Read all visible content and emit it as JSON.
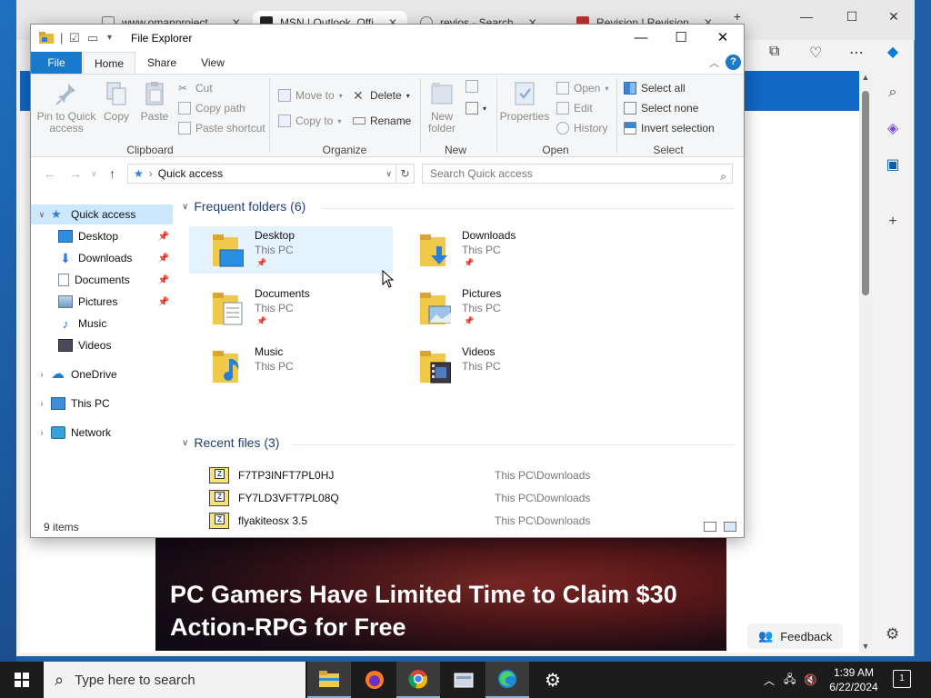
{
  "browser": {
    "tabs": [
      {
        "label": "www.omanproject...",
        "active": false
      },
      {
        "label": "MSN | Outlook, Offi",
        "active": true
      },
      {
        "label": "revios - Search",
        "active": false
      },
      {
        "label": "Revision | Revision",
        "active": false
      }
    ],
    "news_title": "PC Gamers Have Limited Time to Claim $30 Action-RPG for Free",
    "feedback_label": "Feedback",
    "brand_color": "#1168c7"
  },
  "explorer": {
    "title": "File Explorer",
    "ribbon_tabs": [
      "File",
      "Home",
      "Share",
      "View"
    ],
    "clipboard": {
      "pin_label": "Pin to Quick access",
      "copy_label": "Copy",
      "paste_label": "Paste",
      "cut_label": "Cut",
      "copy_path_label": "Copy path",
      "paste_shortcut_label": "Paste shortcut",
      "group_label": "Clipboard"
    },
    "organize": {
      "move_to_label": "Move to",
      "copy_to_label": "Copy to",
      "delete_label": "Delete",
      "rename_label": "Rename",
      "group_label": "Organize"
    },
    "new": {
      "new_folder_label": "New folder",
      "group_label": "New"
    },
    "open": {
      "properties_label": "Properties",
      "open_label": "Open",
      "edit_label": "Edit",
      "history_label": "History",
      "group_label": "Open"
    },
    "select": {
      "select_all_label": "Select all",
      "select_none_label": "Select none",
      "invert_label": "Invert selection",
      "group_label": "Select"
    },
    "address": "Quick access",
    "search_placeholder": "Search Quick access",
    "nav": {
      "quick_access": "Quick access",
      "pinned": [
        "Desktop",
        "Downloads",
        "Documents",
        "Pictures"
      ],
      "unpinned": [
        "Music",
        "Videos"
      ],
      "onedrive": "OneDrive",
      "this_pc": "This PC",
      "network": "Network"
    },
    "frequent_header": "Frequent folders (6)",
    "folders": [
      {
        "name": "Desktop",
        "location": "This PC",
        "pinned": true
      },
      {
        "name": "Downloads",
        "location": "This PC",
        "pinned": true
      },
      {
        "name": "Documents",
        "location": "This PC",
        "pinned": true
      },
      {
        "name": "Pictures",
        "location": "This PC",
        "pinned": true
      },
      {
        "name": "Music",
        "location": "This PC",
        "pinned": false
      },
      {
        "name": "Videos",
        "location": "This PC",
        "pinned": false
      }
    ],
    "recent_header": "Recent files (3)",
    "recent_files": [
      {
        "name": "F7TP3INFT7PL0HJ",
        "location": "This PC\\Downloads"
      },
      {
        "name": "FY7LD3VFT7PL08Q",
        "location": "This PC\\Downloads"
      },
      {
        "name": "flyakiteosx 3.5",
        "location": "This PC\\Downloads"
      }
    ],
    "status_count": "9 items",
    "accent_color": "#1979ca"
  },
  "taskbar": {
    "search_placeholder": "Type here to search",
    "time": "1:39 AM",
    "date": "6/22/2024",
    "notification_count": "1"
  }
}
